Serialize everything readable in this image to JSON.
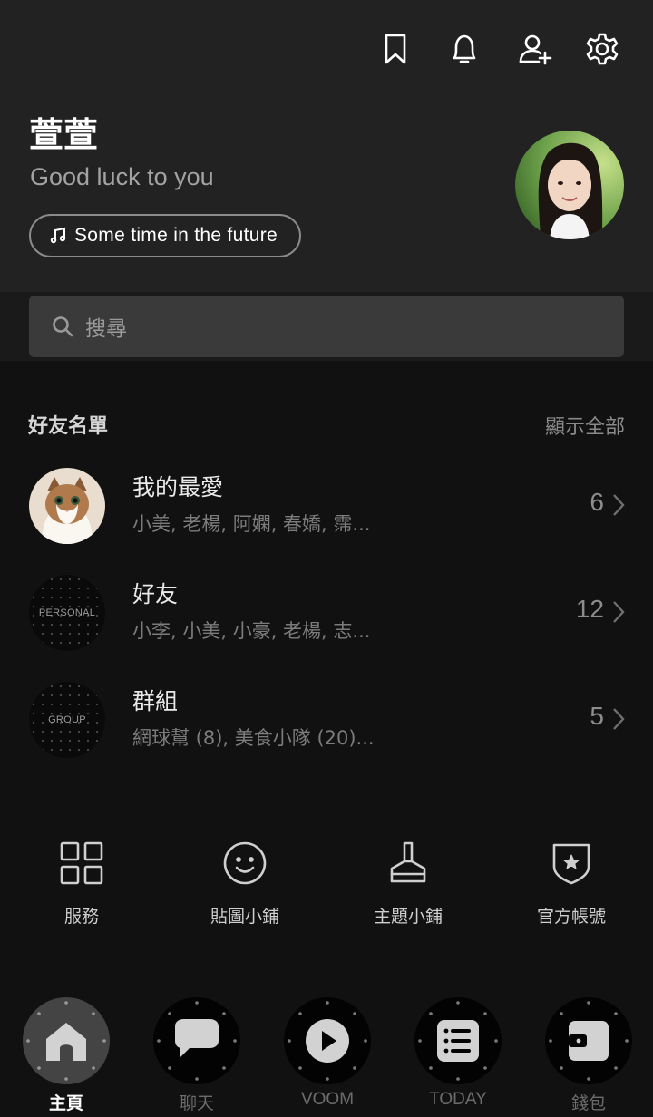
{
  "header": {
    "icons": [
      "bookmark-icon",
      "bell-icon",
      "add-friend-icon",
      "gear-icon"
    ]
  },
  "profile": {
    "name": "萱萱",
    "status": "Good luck to you",
    "music": "Some time in the future"
  },
  "search": {
    "placeholder": "搜尋"
  },
  "friends": {
    "title": "好友名單",
    "show_all": "顯示全部",
    "groups": [
      {
        "name": "我的最愛",
        "members": "小美, 老楊, 阿嫻, 春嬌, 霈...",
        "count": "6"
      },
      {
        "name": "好友",
        "members": "小李, 小美, 小豪, 老楊, 志...",
        "count": "12",
        "badge": "PERSONAL"
      },
      {
        "name": "群組",
        "members": "網球幫 (8), 美食小隊 (20)...",
        "count": "5",
        "badge": "GROUP"
      }
    ]
  },
  "services": [
    {
      "label": "服務",
      "icon": "grid-icon"
    },
    {
      "label": "貼圖小鋪",
      "icon": "smiley-icon"
    },
    {
      "label": "主題小鋪",
      "icon": "brush-icon"
    },
    {
      "label": "官方帳號",
      "icon": "shield-star-icon"
    }
  ],
  "nav": [
    {
      "label": "主頁",
      "icon": "home-icon",
      "active": true
    },
    {
      "label": "聊天",
      "icon": "chat-icon",
      "active": false
    },
    {
      "label": "VOOM",
      "icon": "play-icon",
      "active": false
    },
    {
      "label": "TODAY",
      "icon": "news-icon",
      "active": false
    },
    {
      "label": "錢包",
      "icon": "wallet-icon",
      "active": false
    }
  ]
}
